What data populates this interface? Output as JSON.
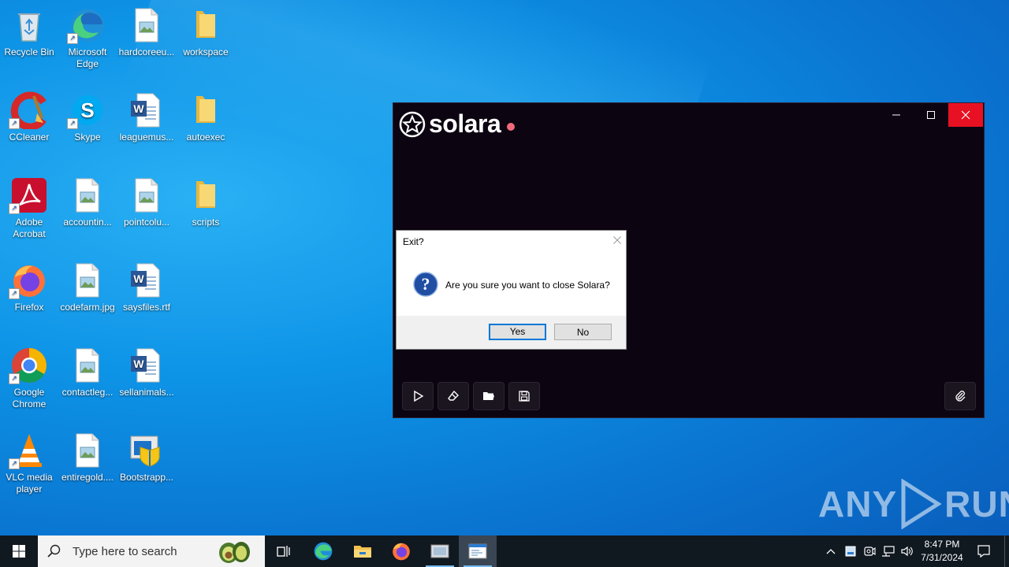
{
  "desktop": {
    "icons": [
      {
        "label": "Recycle Bin",
        "icon": "recycle-bin-icon"
      },
      {
        "label": "Microsoft Edge",
        "icon": "edge-icon"
      },
      {
        "label": "hardcoreeu...",
        "icon": "image-file-icon"
      },
      {
        "label": "workspace",
        "icon": "folder-icon"
      },
      {
        "label": "CCleaner",
        "icon": "ccleaner-icon"
      },
      {
        "label": "Skype",
        "icon": "skype-icon"
      },
      {
        "label": "leaguemus...",
        "icon": "word-doc-icon"
      },
      {
        "label": "autoexec",
        "icon": "folder-icon"
      },
      {
        "label": "Adobe Acrobat",
        "icon": "acrobat-icon"
      },
      {
        "label": "accountin...",
        "icon": "image-file-icon"
      },
      {
        "label": "pointcolu...",
        "icon": "image-file-icon"
      },
      {
        "label": "scripts",
        "icon": "folder-icon"
      },
      {
        "label": "Firefox",
        "icon": "firefox-icon"
      },
      {
        "label": "codefarm.jpg",
        "icon": "image-file-icon"
      },
      {
        "label": "saysfiles.rtf",
        "icon": "word-doc-icon"
      },
      {
        "label": "Google Chrome",
        "icon": "chrome-icon"
      },
      {
        "label": "contactleg...",
        "icon": "image-file-icon"
      },
      {
        "label": "sellanimals...",
        "icon": "word-doc-icon"
      },
      {
        "label": "VLC media player",
        "icon": "vlc-icon"
      },
      {
        "label": "entiregold....",
        "icon": "image-file-icon"
      },
      {
        "label": "Bootstrapp...",
        "icon": "installer-icon"
      }
    ]
  },
  "solara_window": {
    "logo_text": "solara",
    "status_color": "#f26a7a",
    "tools": [
      "play-icon",
      "eraser-icon",
      "open-folder-icon",
      "save-icon",
      "attach-icon"
    ]
  },
  "dialog": {
    "title": "Exit?",
    "message": "Are you sure you want to close Solara?",
    "yes_label": "Yes",
    "no_label": "No"
  },
  "watermark": {
    "text_left": "ANY",
    "text_right": "RUN"
  },
  "taskbar": {
    "search_placeholder": "Type here to search",
    "time": "8:47 PM",
    "date": "7/31/2024"
  },
  "colors": {
    "accent": "#0078d7",
    "close_red": "#e81123",
    "solara_bg": "#0c0511"
  }
}
